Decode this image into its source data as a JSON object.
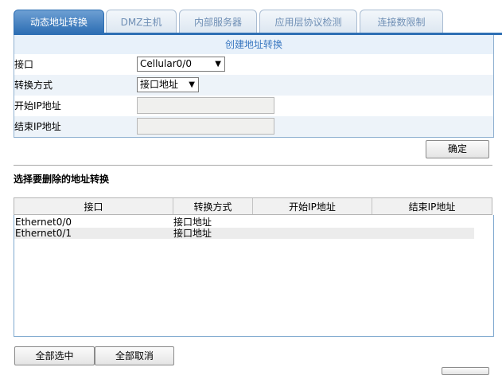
{
  "tabs": [
    "动态地址转换",
    "DMZ主机",
    "内部服务器",
    "应用层协议检测",
    "连接数限制"
  ],
  "form": {
    "title": "创建地址转换",
    "interface_label": "接口",
    "interface_value": "Cellular0/0",
    "mode_label": "转换方式",
    "mode_value": "接口地址",
    "start_ip_label": "开始IP地址",
    "end_ip_label": "结束IP地址",
    "confirm_button": "确定"
  },
  "delete_section": {
    "title": "选择要删除的地址转换",
    "columns": [
      "接口",
      "转换方式",
      "开始IP地址",
      "结束IP地址"
    ],
    "rows": [
      {
        "interface": "Ethernet0/0",
        "mode": "接口地址",
        "start_ip": "",
        "end_ip": ""
      },
      {
        "interface": "Ethernet0/1",
        "mode": "接口地址",
        "start_ip": "",
        "end_ip": ""
      }
    ]
  },
  "footer": {
    "select_all": "全部选中",
    "deselect_all": "全部取消"
  },
  "icons": {
    "dropdown_arrow": "▼"
  },
  "colors": {
    "active_tab": "#2e6fb4",
    "form_title": "#3a78c0"
  }
}
